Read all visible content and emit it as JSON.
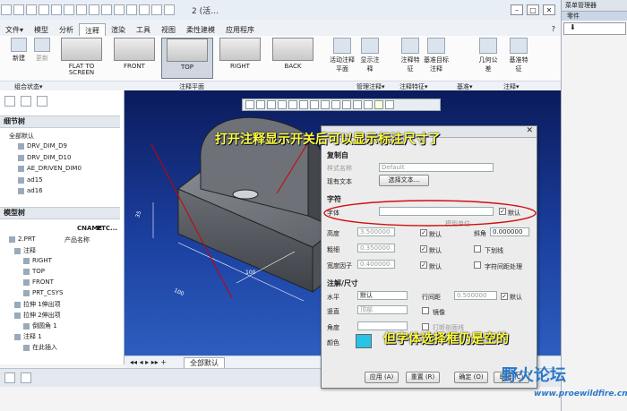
{
  "window": {
    "title": "2 (活…",
    "controls": [
      "–",
      "□",
      "✕"
    ]
  },
  "menu": {
    "file": "文件▾",
    "tabs": [
      "模型",
      "分析",
      "注释",
      "渲染",
      "工具",
      "视图",
      "柔性建模",
      "应用程序"
    ],
    "active": "注释",
    "help": "?"
  },
  "ribbon": {
    "left_buttons": [
      "新建",
      "更新"
    ],
    "views": [
      "FLAT TO SCREEN",
      "FRONT",
      "TOP",
      "RIGHT",
      "BACK"
    ],
    "selected_view": "TOP",
    "tools": [
      "活动注释平面",
      "显示注释",
      "注释特征",
      "基准目标注释",
      "几何公差",
      "基准特征"
    ],
    "groups": [
      "组合状态▾",
      "注释平面",
      "管理注释▾",
      "注释特征▾",
      "基准▾",
      "注释▾"
    ]
  },
  "detail_tree": {
    "title": "细节树",
    "items": [
      "全部默认",
      "DRV_DIM_D9",
      "DRV_DIM_D10",
      "AE_DRIVEN_DIM0",
      "ad15",
      "ad16"
    ]
  },
  "model_tree": {
    "title": "模型树",
    "columns": [
      "CNAME",
      "PTC..."
    ],
    "items": [
      "2.PRT",
      "注释",
      "RIGHT",
      "TOP",
      "FRONT",
      "PRT_CSYS",
      "拉伸 1伸出项",
      "拉伸 2伸出项",
      "倒圆角 1",
      "注释 1",
      "在此插入"
    ],
    "cname": "产品名称"
  },
  "graphics": {
    "dims": [
      "100",
      "35",
      "100"
    ]
  },
  "tabs_bottom": {
    "label": "全部默认"
  },
  "right_panel": {
    "title": "菜单管理器",
    "item": "零件",
    "arrow": "⬇"
  },
  "dialog": {
    "copy_from": "复制自",
    "style_name_label": "样式名称",
    "style_name": "Default",
    "existing_text_label": "现有文本",
    "select_text": "选择文本...",
    "char_section": "字符",
    "font_label": "字体",
    "font_value": "",
    "default": "默认",
    "height_label": "高度",
    "height": "3.500000",
    "units": "模型单位",
    "slant_label": "斜角",
    "slant": "0.000000",
    "thickness_label": "粗细",
    "thickness": "0.350000",
    "underline": "下划线",
    "width_label": "宽度因子",
    "width": "0.400000",
    "kerning": "字符间距处理",
    "note_section": "注解/尺寸",
    "h_label": "水平",
    "h_value": "默认",
    "line_spacing_label": "行间距",
    "line_spacing": "0.500000",
    "v_label": "竖直",
    "v_value": "顶部",
    "mirror": "镜像",
    "angle_label": "角度",
    "break_hatch": "打断剖面线",
    "color_label": "颜色",
    "apply": "应用 (A)",
    "reset": "重置 (R)",
    "ok": "确定 (O)",
    "cancel": "取消 (C)"
  },
  "annotations": {
    "top": "打开注释显示开关后可以显示标注尺寸了",
    "bottom": "但字体选择框仍是空的"
  },
  "watermark": {
    "title": "野火论坛",
    "url": "www.proewildfire.cn"
  }
}
